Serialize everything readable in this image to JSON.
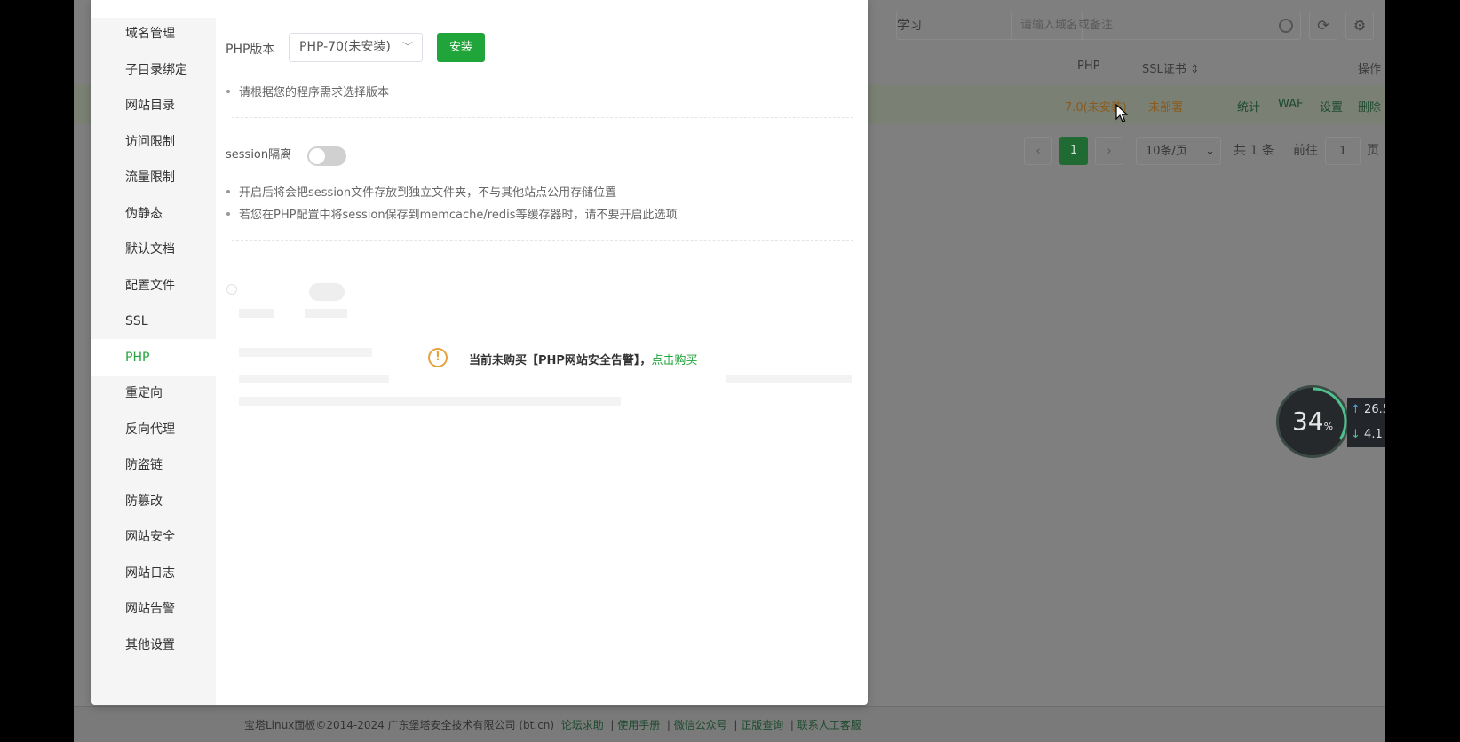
{
  "background": {
    "category_select": "学习",
    "search_placeholder": "请输入域名或备注",
    "columns": {
      "php": "PHP",
      "ssl": "SSL证书",
      "ops": "操作"
    },
    "row": {
      "php": "7.0(未安装)",
      "ssl": "未部署",
      "stats": "统计",
      "waf": "WAF",
      "settings": "设置",
      "delete": "删除"
    },
    "pager": {
      "prev": "‹",
      "current": "1",
      "next": "›",
      "page_size": "10条/页",
      "total": "共 1 条",
      "goto": "前往",
      "goto_value": "1",
      "page_unit": "页"
    },
    "footer": {
      "copyright": "宝塔Linux面板©2014-2024 广东堡塔安全技术有限公司 (bt.cn)",
      "links": [
        "论坛求助",
        "使用手册",
        "微信公众号",
        "正版查询",
        "联系人工客服"
      ]
    }
  },
  "gauge": {
    "value": "34",
    "unit": "%",
    "percent": 34,
    "up": "26.5",
    "down": "4.1"
  },
  "sidebar": {
    "items": [
      "域名管理",
      "子目录绑定",
      "网站目录",
      "访问限制",
      "流量限制",
      "伪静态",
      "默认文档",
      "配置文件",
      "SSL",
      "PHP",
      "重定向",
      "反向代理",
      "防盗链",
      "防篡改",
      "网站安全",
      "网站日志",
      "网站告警",
      "其他设置"
    ],
    "active_index": 9
  },
  "php": {
    "version_label": "PHP版本",
    "version_value": "PHP-70(未安装)",
    "install_button": "安装",
    "version_tip": "请根据您的程序需求选择版本",
    "session_label": "session隔离",
    "session_tips": [
      "开启后将会把session文件存放到独立文件夹，不与其他站点公用存储位置",
      "若您在PHP配置中将session保存到memcache/redis等缓存器时，请不要开启此选项"
    ]
  },
  "security_overlay": {
    "message": "当前未购买【PHP网站安全告警】，",
    "link": "点击购买"
  }
}
